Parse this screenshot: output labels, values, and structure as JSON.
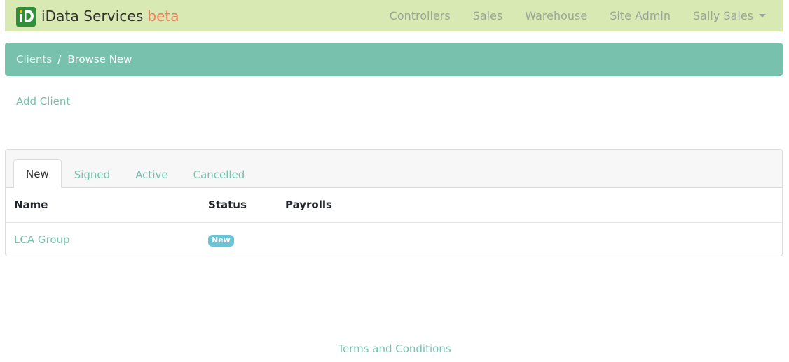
{
  "navbar": {
    "brand": "iData Services",
    "beta": "beta",
    "links": [
      "Controllers",
      "Sales",
      "Warehouse",
      "Site Admin"
    ],
    "user_menu": "Sally Sales",
    "logo_icon": "idata-logo-icon",
    "background": "#d9e9b3",
    "beta_color": "#f0805a"
  },
  "breadcrumb": {
    "parent": "Clients",
    "separator": "/",
    "current": "Browse New",
    "background": "#78c2ad"
  },
  "actions": {
    "add_client": "Add Client"
  },
  "tabs": [
    {
      "label": "New",
      "active": true
    },
    {
      "label": "Signed",
      "active": false
    },
    {
      "label": "Active",
      "active": false
    },
    {
      "label": "Cancelled",
      "active": false
    }
  ],
  "table": {
    "headers": [
      "Name",
      "Status",
      "Payrolls"
    ],
    "rows": [
      {
        "name": "LCA Group",
        "status": "New",
        "payrolls": ""
      }
    ]
  },
  "footer": {
    "terms": "Terms and Conditions"
  },
  "colors": {
    "accent": "#78c2ad",
    "badge": "#6cc3d5"
  }
}
